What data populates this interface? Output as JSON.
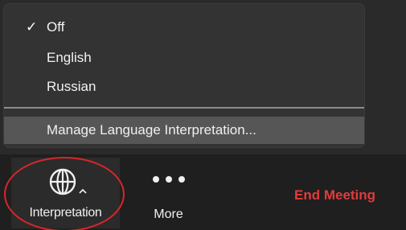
{
  "menu": {
    "items": [
      {
        "label": "Off",
        "checked": true,
        "check_mark": "✓"
      },
      {
        "label": "English",
        "checked": false
      },
      {
        "label": "Russian",
        "checked": false
      }
    ],
    "manage_label": "Manage Language Interpretation..."
  },
  "toolbar": {
    "interpretation": {
      "label": "Interpretation",
      "icon": "globe-icon"
    },
    "more": {
      "label": "More",
      "icon": "ellipsis-icon"
    },
    "end_meeting": {
      "label": "End Meeting"
    }
  },
  "colors": {
    "menu_bg": "#333333",
    "menu_highlight": "#565656",
    "toolbar_bg": "#1f1f1f",
    "end_meeting": "#e23b3b",
    "annotation_circle": "#d9262b"
  }
}
